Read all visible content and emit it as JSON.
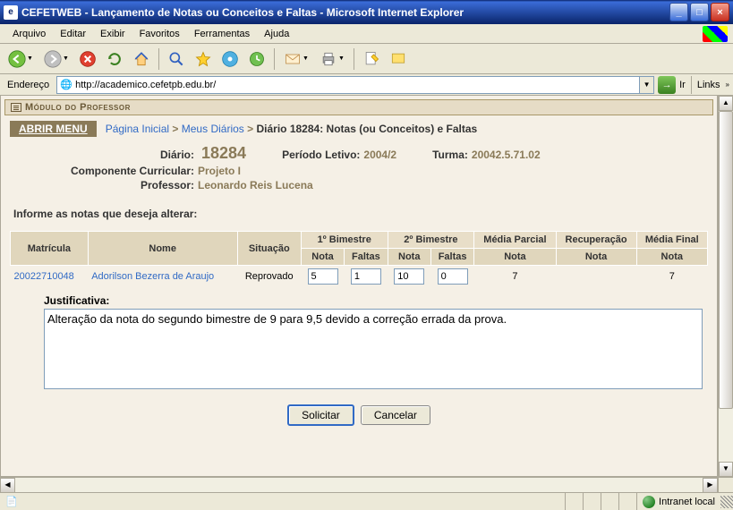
{
  "window": {
    "title": "CEFETWEB - Lançamento de Notas ou Conceitos e Faltas - Microsoft Internet Explorer"
  },
  "menu": {
    "arquivo": "Arquivo",
    "editar": "Editar",
    "exibir": "Exibir",
    "favoritos": "Favoritos",
    "ferramentas": "Ferramentas",
    "ajuda": "Ajuda"
  },
  "addressbar": {
    "label": "Endereço",
    "url": "http://academico.cefetpb.edu.br/",
    "go": "Ir",
    "links": "Links"
  },
  "module": {
    "title": "Módulo do Professor"
  },
  "breadcrumb": {
    "open_menu": "ABRIR MENU",
    "home": "Página Inicial",
    "diaries": "Meus Diários",
    "current": "Diário 18284: Notas (ou Conceitos) e Faltas"
  },
  "info": {
    "diario_label": "Diário:",
    "diario_value": "18284",
    "periodo_label": "Período Letivo:",
    "periodo_value": "2004/2",
    "turma_label": "Turma:",
    "turma_value": "20042.5.71.02",
    "componente_label": "Componente Curricular:",
    "componente_value": "Projeto I",
    "professor_label": "Professor:",
    "professor_value": "Leonardo Reis Lucena"
  },
  "prompt": "Informe as notas que deseja alterar:",
  "table": {
    "headers": {
      "matricula": "Matrícula",
      "nome": "Nome",
      "situacao": "Situação",
      "bim1": "1º Bimestre",
      "bim2": "2º Bimestre",
      "media_parcial": "Média Parcial",
      "recuperacao": "Recuperação",
      "media_final": "Média Final",
      "nota": "Nota",
      "faltas": "Faltas"
    },
    "rows": [
      {
        "matricula": "20022710048",
        "nome": "Adorilson Bezerra de Araujo",
        "situacao": "Reprovado",
        "nota1": "5",
        "faltas1": "1",
        "nota2": "10",
        "faltas2": "0",
        "media_parcial": "7",
        "recuperacao": "",
        "media_final": "7"
      }
    ]
  },
  "justificativa": {
    "label": "Justificativa:",
    "text": "Alteração da nota do segundo bimestre de 9 para 9,5 devido a correção errada da prova."
  },
  "actions": {
    "solicitar": "Solicitar",
    "cancelar": "Cancelar"
  },
  "statusbar": {
    "intranet": "Intranet local"
  }
}
